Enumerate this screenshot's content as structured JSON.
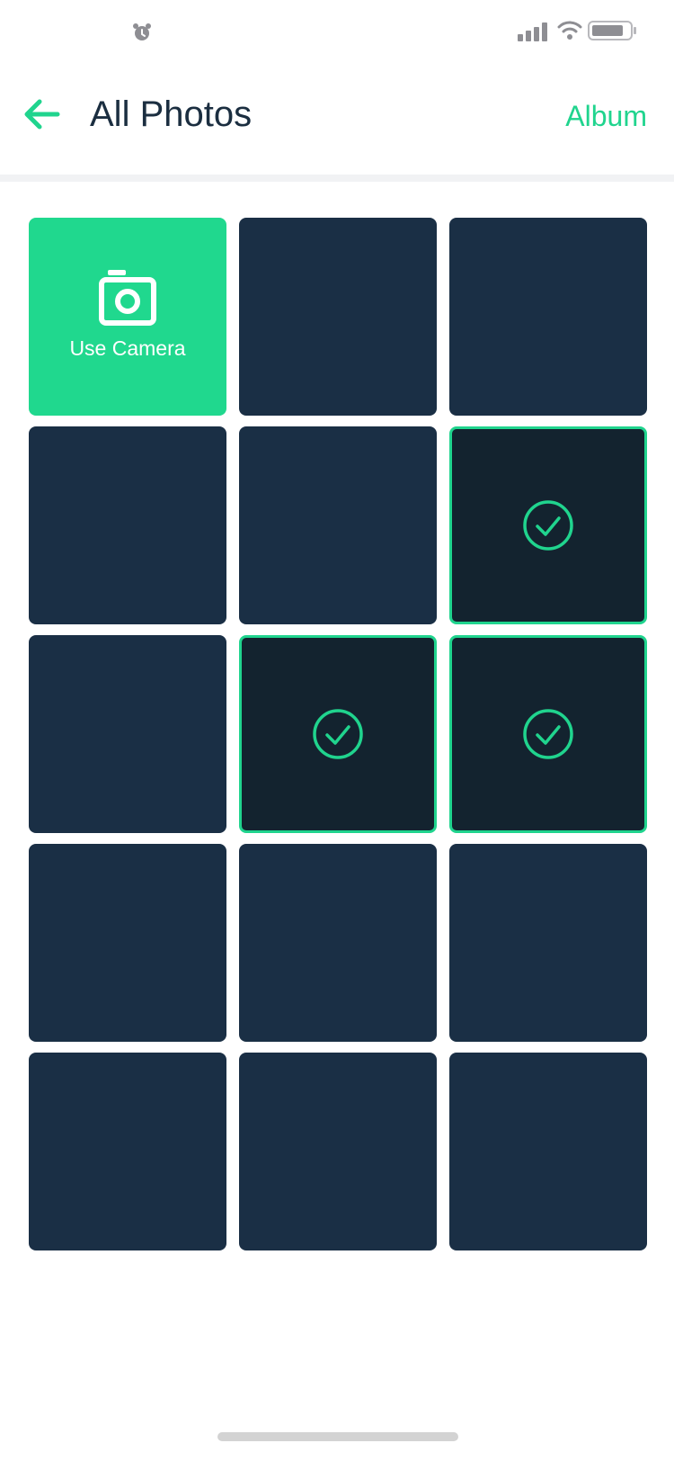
{
  "colors": {
    "accent": "#20d48e",
    "title": "#1b2e40",
    "tile": "#1a2f45",
    "tile_selected": "#13232f"
  },
  "status_bar": {
    "icons": [
      "alarm-icon",
      "signal-icon",
      "wifi-icon",
      "battery-icon"
    ]
  },
  "header": {
    "back_icon": "arrow-left-icon",
    "title": "All Photos",
    "album_label": "Album"
  },
  "grid": {
    "camera_label": "Use Camera",
    "tiles": [
      {
        "type": "camera"
      },
      {
        "selected": false
      },
      {
        "selected": false
      },
      {
        "selected": false
      },
      {
        "selected": false
      },
      {
        "selected": true
      },
      {
        "selected": false
      },
      {
        "selected": true
      },
      {
        "selected": true
      },
      {
        "selected": false
      },
      {
        "selected": false
      },
      {
        "selected": false
      },
      {
        "selected": false
      },
      {
        "selected": false
      },
      {
        "selected": false
      }
    ]
  }
}
